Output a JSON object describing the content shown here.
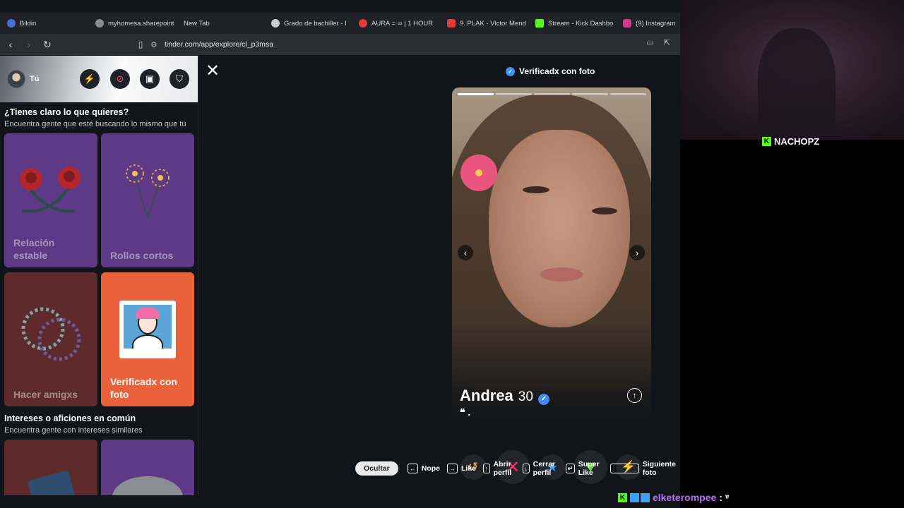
{
  "tabs": [
    {
      "title": "Bildin",
      "color": "#4b6fd4"
    },
    {
      "title": "myhomesa.sharepoint",
      "color": "#8a8d91"
    },
    {
      "title": "New Tab",
      "color": ""
    },
    {
      "title": "Grado de bachiller - I",
      "color": "#c8cbcf"
    },
    {
      "title": "AURA = ∞ | 1 HOUR",
      "color": "#e33b3b"
    },
    {
      "title": "9. PLAK - Victor Mend",
      "color": "#e33b3b"
    },
    {
      "title": "Stream - Kick Dashbo",
      "color": "#53fc18"
    },
    {
      "title": "(9) Instagram",
      "color": "#d6388a"
    }
  ],
  "address": {
    "url": "tinder.com/app/explore/cl_p3msa"
  },
  "sidebar": {
    "user_label": "Tú",
    "section1": {
      "title": "¿Tienes claro lo que quieres?",
      "subtitle": "Encuentra gente que esté buscando lo mismo que tú"
    },
    "cards": [
      {
        "label": "Relación estable",
        "bg": "#5e3a86"
      },
      {
        "label": "Rollos cortos",
        "bg": "#5e3a86"
      },
      {
        "label": "Hacer amigxs",
        "bg": "#5e2a2c"
      },
      {
        "label": "Verificadx con foto",
        "bg": "#e9623c"
      }
    ],
    "section2": {
      "title": "Intereses o aficiones en común",
      "subtitle": "Encuentra gente con intereses similares"
    }
  },
  "profile": {
    "verified_label": "Verificadx con foto",
    "name": "Andrea",
    "age": "30",
    "quote": "❝ ."
  },
  "shortcuts": {
    "hide": "Ocultar",
    "nope": "Nope",
    "like": "Like",
    "open_profile": "Abrir perfil",
    "close_profile": "Cerrar perfil",
    "super_like": "Super Like",
    "next_photo": "Siguiente foto"
  },
  "stream": {
    "streamer": "NACHOPZ",
    "chat_user": "elketerompee",
    "chat_msg": ": ᵄ"
  }
}
